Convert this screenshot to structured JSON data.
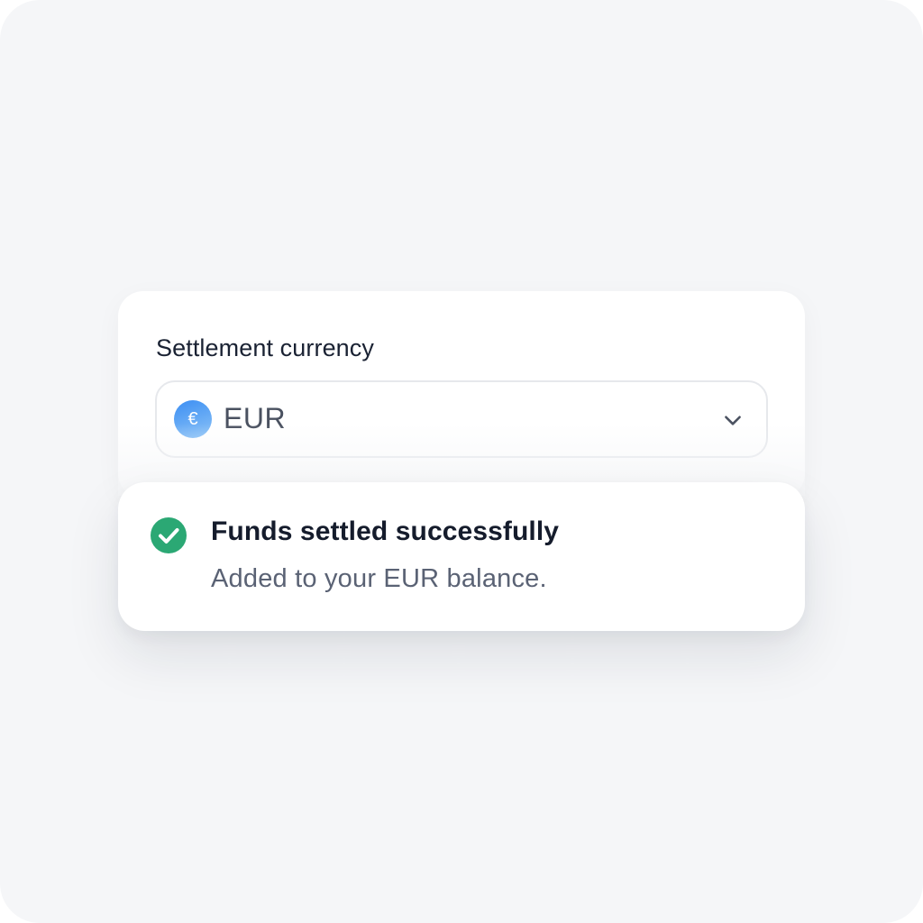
{
  "settlement": {
    "label": "Settlement currency",
    "currency_symbol": "€",
    "selected_currency": "EUR"
  },
  "toast": {
    "title": "Funds settled successfully",
    "message": "Added to your EUR balance."
  },
  "colors": {
    "success": "#2ba874",
    "currency_badge": "#4b9cf4",
    "background": "#f5f6f8"
  },
  "icons": {
    "currency": "euro-icon",
    "dropdown": "chevron-down-icon",
    "status": "check-circle-icon"
  }
}
